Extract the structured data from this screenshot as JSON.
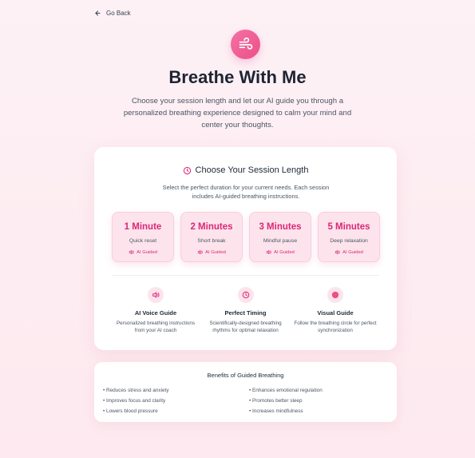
{
  "nav": {
    "back_label": "Go Back",
    "back_icon": "arrow-left-icon"
  },
  "hero": {
    "icon": "wind-icon",
    "title": "Breathe With Me",
    "subtitle": "Choose your session length and let our AI guide you through a personalized breathing experience designed to calm your mind and center your thoughts."
  },
  "session_card": {
    "title": "Choose Your Session Length",
    "title_icon": "clock-icon",
    "description": "Select the perfect duration for your current needs. Each session includes AI-guided breathing instructions.",
    "sessions": [
      {
        "length": "1 Minute",
        "label": "Quick reset",
        "badge": "AI Guided"
      },
      {
        "length": "2 Minutes",
        "label": "Short break",
        "badge": "AI Guided"
      },
      {
        "length": "3 Minutes",
        "label": "Mindful pause",
        "badge": "AI Guided"
      },
      {
        "length": "5 Minutes",
        "label": "Deep relaxation",
        "badge": "AI Guided"
      }
    ],
    "features": [
      {
        "icon": "voice-icon",
        "name": "AI Voice Guide",
        "description": "Personalized breathing instructions from your AI coach"
      },
      {
        "icon": "timer-icon",
        "name": "Perfect Timing",
        "description": "Scientifically-designed breathing rhythms for optimal relaxation"
      },
      {
        "icon": "circle-icon",
        "name": "Visual Guide",
        "description": "Follow the breathing circle for perfect synchronization"
      }
    ]
  },
  "benefits": {
    "title": "Benefits of Guided Breathing",
    "left": [
      "• Reduces stress and anxiety",
      "• Improves focus and clarity",
      "• Lowers blood pressure"
    ],
    "right": [
      "• Enhances emotional regulation",
      "• Promotes better sleep",
      "• Increases mindfulness"
    ]
  },
  "colors": {
    "accent": "#ec4899",
    "accent_dark": "#db2777",
    "tile_bg": "#fde4ec"
  }
}
